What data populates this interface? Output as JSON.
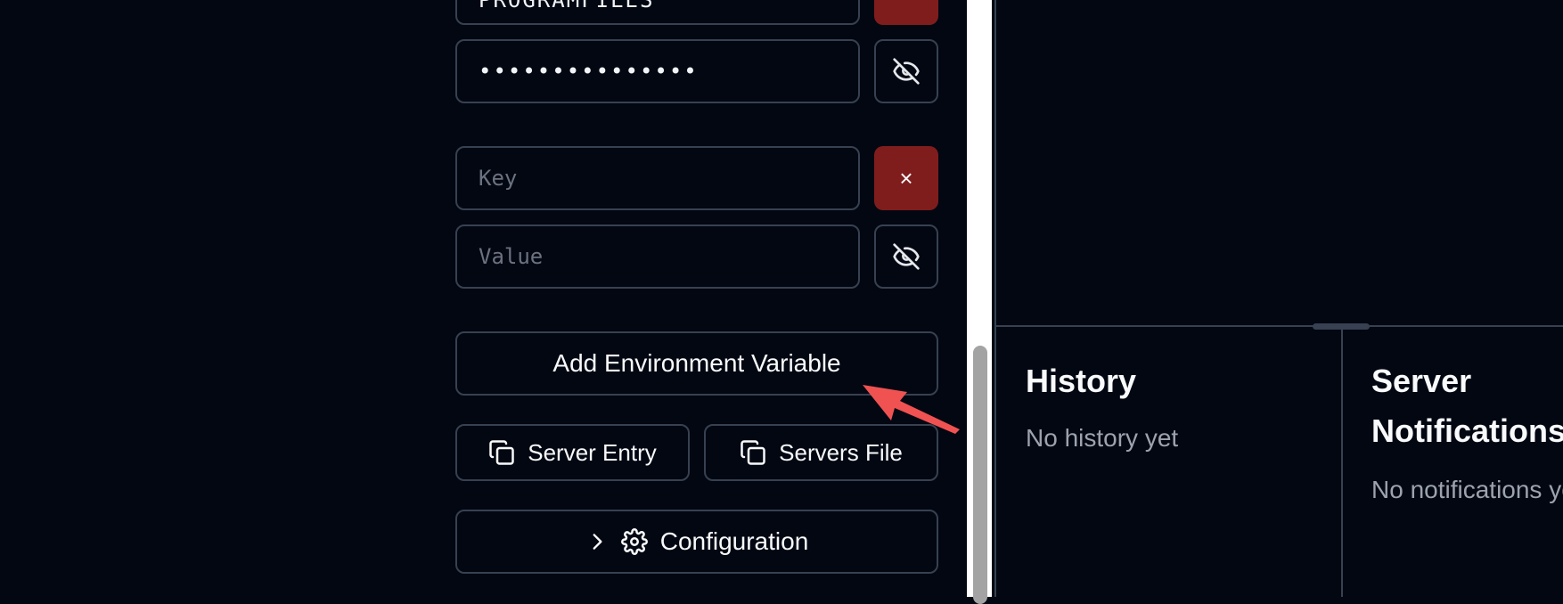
{
  "env_vars": {
    "rows": [
      {
        "key_value": "PROGRAMFILES",
        "value_masked": "•••••••••••••••",
        "remove_label": "×"
      },
      {
        "key_placeholder": "Key",
        "value_placeholder": "Value",
        "remove_label": "×"
      }
    ],
    "add_label": "Add Environment Variable"
  },
  "actions": {
    "server_entry_label": "Server Entry",
    "servers_file_label": "Servers File"
  },
  "config": {
    "label": "Configuration"
  },
  "history": {
    "title": "History",
    "empty": "No history yet"
  },
  "notifications": {
    "title_line1": "Server",
    "title_line2": "Notifications",
    "empty": "No notifications yet"
  },
  "colors": {
    "background": "#030712",
    "border": "#374151",
    "danger": "#7f1d1d",
    "arrow": "#f05252"
  },
  "icons": [
    "eye-off-icon",
    "close-icon",
    "copy-icon",
    "chevron-right-icon",
    "gear-icon"
  ]
}
